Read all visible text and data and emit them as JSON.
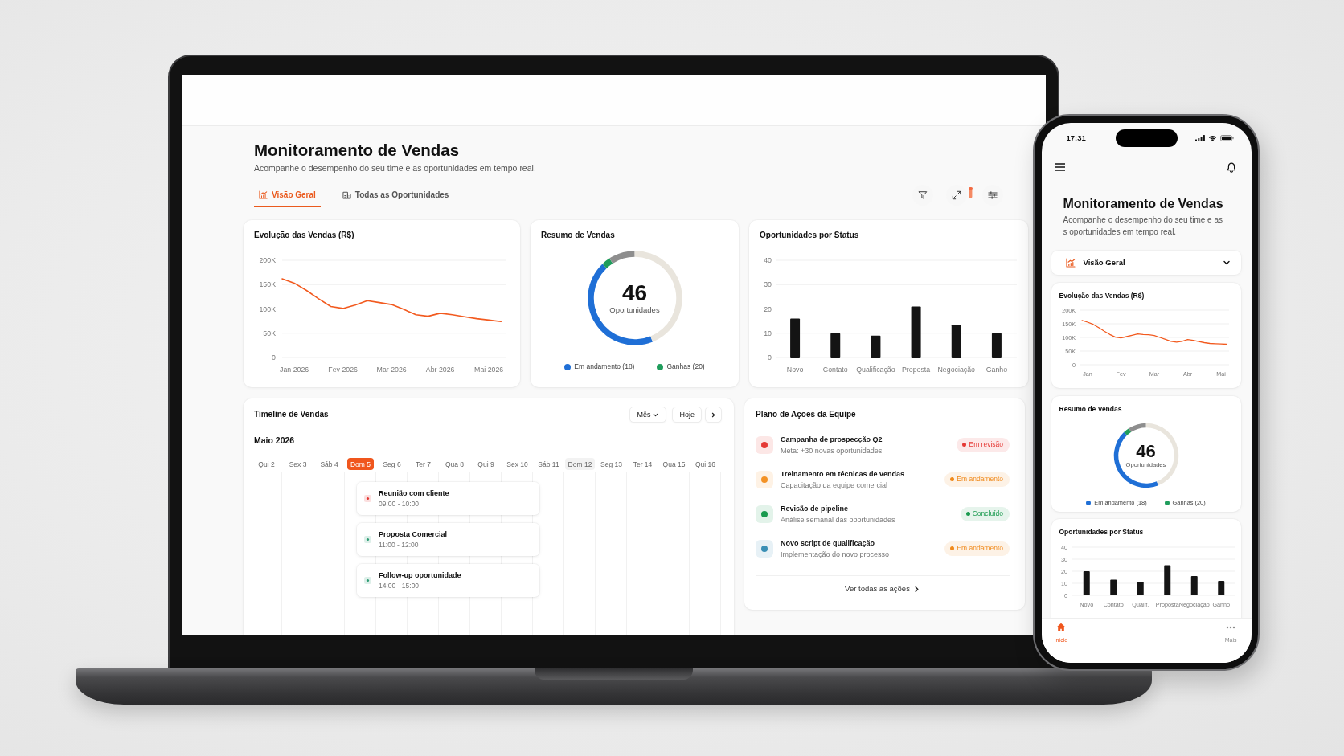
{
  "laptop": {
    "header": {
      "title": "Monitoramento de Vendas",
      "subtitle": "Acompanhe o desempenho do seu time e as oportunidades em tempo real."
    },
    "tabs": [
      {
        "label": "Visão Geral",
        "selected": true
      },
      {
        "label": "Todas as Oportunidades",
        "selected": false
      }
    ],
    "sales_chart": {
      "title": "Evolução das Vendas (R$)",
      "chart_data": {
        "type": "line",
        "categories": [
          null,
          "Jan 2026",
          null,
          null,
          null,
          "Fev 2026",
          null,
          null,
          null,
          "Mar 2026",
          null,
          null,
          null,
          "Abr 2026",
          null,
          null,
          null,
          "Mai 2026",
          null
        ],
        "values": [
          162000,
          153000,
          138000,
          121000,
          105000,
          101000,
          108000,
          117000,
          113000,
          109000,
          99000,
          88000,
          85000,
          91000,
          88000,
          84000,
          80000,
          77000,
          74000
        ],
        "ylim": [
          0,
          200000
        ],
        "yticks": [
          {
            "value": 0,
            "label": "0"
          },
          {
            "value": 50000,
            "label": "50K"
          },
          {
            "value": 100000,
            "label": "100K"
          },
          {
            "value": 150000,
            "label": "150K"
          },
          {
            "value": 200000,
            "label": "200K"
          }
        ],
        "grid": true
      }
    },
    "summary": {
      "title": "Resumo de Vendas",
      "total": "46",
      "total_label": "Oportunidades",
      "chart_data": {
        "type": "donut",
        "categories": [
          "Em andamento (18)",
          "Ganhas (20)",
          null,
          null
        ],
        "values": [
          44,
          3,
          9,
          44
        ],
        "colors": [
          "#1f6fd6",
          "#1f9d5c",
          "#8e8e8e",
          "#e9e5dd"
        ]
      }
    },
    "status_chart": {
      "title": "Oportunidades por Status",
      "chart_data": {
        "type": "bar",
        "categories": [
          "Novo",
          "Contato",
          "Qualificação",
          "Proposta",
          "Negociação",
          "Ganho"
        ],
        "values": [
          16,
          10,
          9,
          21,
          13.5,
          10
        ],
        "ylim": [
          0,
          40
        ],
        "yticks": [
          0,
          10,
          20,
          30,
          40
        ],
        "grid": true
      }
    },
    "timeline": {
      "title": "Timeline de Vendas",
      "view_select": "Mês",
      "today_button": "Hoje",
      "month": "Maio 2026",
      "days": [
        {
          "label": "Qui 2",
          "selected": false,
          "highlighted": false
        },
        {
          "label": "Sex 3",
          "selected": false,
          "highlighted": false
        },
        {
          "label": "Sáb 4",
          "selected": false,
          "highlighted": false
        },
        {
          "label": "Dom 5",
          "selected": true,
          "highlighted": false
        },
        {
          "label": "Seg 6",
          "selected": false,
          "highlighted": false
        },
        {
          "label": "Ter 7",
          "selected": false,
          "highlighted": false
        },
        {
          "label": "Qua 8",
          "selected": false,
          "highlighted": false
        },
        {
          "label": "Qui 9",
          "selected": false,
          "highlighted": false
        },
        {
          "label": "Sex 10",
          "selected": false,
          "highlighted": false
        },
        {
          "label": "Sáb 11",
          "selected": false,
          "highlighted": false
        },
        {
          "label": "Dom 12",
          "selected": false,
          "highlighted": true
        },
        {
          "label": "Seg 13",
          "selected": false,
          "highlighted": false
        },
        {
          "label": "Ter 14",
          "selected": false,
          "highlighted": false
        },
        {
          "label": "Qua 15",
          "selected": false,
          "highlighted": false
        },
        {
          "label": "Qui 16",
          "selected": false,
          "highlighted": false
        }
      ],
      "events": [
        {
          "title": "Reunião com cliente",
          "time": "09:00 - 10:00",
          "color": "#e53935"
        },
        {
          "title": "Proposta Comercial",
          "time": "11:00 - 12:00",
          "color": "#2e9c74"
        },
        {
          "title": "Follow-up oportunidade",
          "time": "14:00 - 15:00",
          "color": "#2e9c74"
        }
      ]
    },
    "action_plan": {
      "title": "Plano de Ações da Equipe",
      "items": [
        {
          "title": "Campanha de prospecção Q2",
          "description": "Meta: +30 novas oportunidades",
          "color": "#e53935",
          "badge": {
            "label": "Em revisão",
            "color": "#e53935"
          }
        },
        {
          "title": "Treinamento em técnicas de vendas",
          "description": "Capacitação da equipe comercial",
          "color": "#f39226",
          "badge": {
            "label": "Em andamento",
            "color": "#f08a1c"
          }
        },
        {
          "title": "Revisão de pipeline",
          "description": "Análise semanal das oportunidades",
          "color": "#1a9a4f",
          "badge": {
            "label": "Concluído",
            "color": "#1a9a4f"
          }
        },
        {
          "title": "Novo script de qualificação",
          "description": "Implementação do novo processo",
          "color": "#3a8fb5",
          "badge": {
            "label": "Em andamento",
            "color": "#f08a1c"
          }
        }
      ],
      "footer_link": "Ver todas as ações"
    }
  },
  "phone": {
    "status_bar": {
      "time": "17:31"
    },
    "header": {
      "title": "Monitoramento de Vendas",
      "subtitle": "Acompanhe o desempenho do seu time e as s oportunidades em tempo real."
    },
    "view_select": {
      "label": "Visão Geral"
    },
    "sales_chart": {
      "title": "Evolução das Vendas (R$)",
      "chart_data": {
        "type": "line",
        "categories": [
          null,
          "Jan",
          null,
          null,
          null,
          null,
          null,
          "Fev",
          null,
          null,
          null,
          null,
          null,
          "Mar",
          null,
          null,
          null,
          null,
          null,
          "Abr",
          null,
          null,
          null,
          null,
          null,
          "Mai",
          null
        ],
        "values": [
          162000,
          156000,
          148000,
          136000,
          123000,
          111000,
          101000,
          98000,
          103000,
          108000,
          113000,
          111000,
          110000,
          107000,
          100000,
          93000,
          86000,
          83000,
          86000,
          92000,
          89000,
          85000,
          81000,
          78000,
          77000,
          76000,
          75000
        ],
        "ylim": [
          0,
          200000
        ],
        "yticks": [
          {
            "value": 0,
            "label": "0"
          },
          {
            "value": 50000,
            "label": "50K"
          },
          {
            "value": 100000,
            "label": "100K"
          },
          {
            "value": 150000,
            "label": "150K"
          },
          {
            "value": 200000,
            "label": "200K"
          }
        ],
        "grid": true
      }
    },
    "summary": {
      "title": "Resumo de Vendas",
      "total": "46",
      "total_label": "Oportunidades",
      "chart_data": {
        "type": "donut",
        "categories": [
          "Em andamento (18)",
          "Ganhas (20)",
          null,
          null
        ],
        "values": [
          44,
          3,
          9,
          44
        ],
        "colors": [
          "#1f6fd6",
          "#1f9d5c",
          "#8e8e8e",
          "#e9e5dd"
        ]
      }
    },
    "status_chart": {
      "title": "Oportunidades por Status",
      "chart_data": {
        "type": "bar",
        "categories": [
          "Novo",
          "Contato",
          "Qualif.",
          "Proposta",
          "Negociação",
          "Ganho"
        ],
        "values": [
          20,
          13,
          11,
          25,
          16,
          12
        ],
        "ylim": [
          0,
          40
        ],
        "yticks": [
          0,
          10,
          20,
          30,
          40
        ],
        "grid": true
      }
    },
    "bottom_nav": [
      {
        "label": "Início",
        "selected": true
      },
      {
        "label": "Mais",
        "selected": false
      }
    ]
  }
}
